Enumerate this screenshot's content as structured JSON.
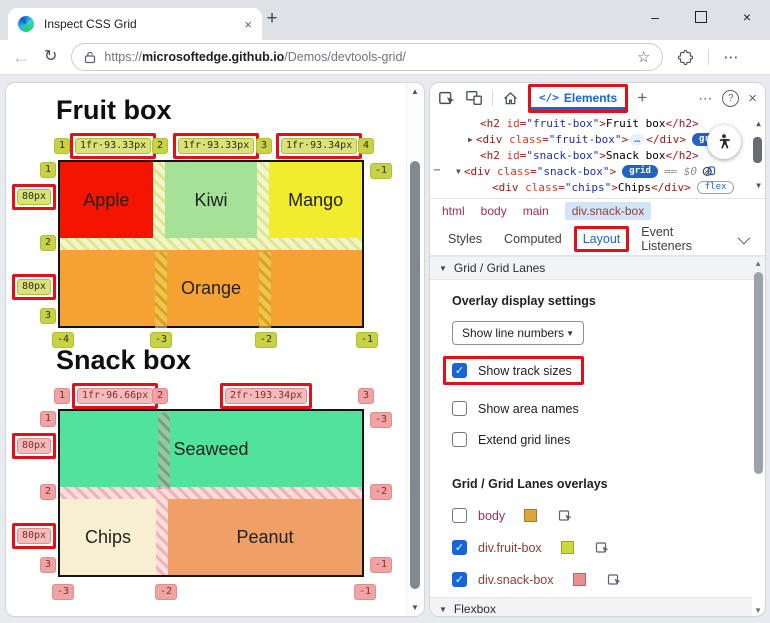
{
  "browser": {
    "tab_title": "Inspect CSS Grid",
    "url": {
      "scheme": "https://",
      "host": "microsoftedge.github.io",
      "path": "/Demos/devtools-grid/"
    },
    "icons": {
      "back": "←",
      "refresh": "↻",
      "star": "☆",
      "more": "⋯",
      "new_tab": "+",
      "tab_close": "×",
      "minimize": "–",
      "close": "×"
    }
  },
  "page": {
    "fruit": {
      "title": "Fruit box",
      "cells": [
        "Apple",
        "Kiwi",
        "Mango",
        "Orange"
      ],
      "top_lines": [
        "1",
        "2",
        "3",
        "4"
      ],
      "tracks": [
        "1fr·93.33px",
        "1fr·93.33px",
        "1fr·93.34px"
      ],
      "left_lines": [
        "1",
        "2",
        "3"
      ],
      "row_size": "80px",
      "right_line": "-1",
      "bottom_lines": [
        "-4",
        "-3",
        "-2",
        "-1"
      ]
    },
    "snack": {
      "title": "Snack box",
      "cells": [
        "Seaweed",
        "Chips",
        "Peanut"
      ],
      "top_lines": [
        "1",
        "2",
        "3"
      ],
      "tracks": [
        "1fr·96.66px",
        "2fr·193.34px"
      ],
      "left_lines": [
        "1",
        "2",
        "3"
      ],
      "row_size": "80px",
      "right_lines": [
        "-3",
        "-2",
        "-1"
      ],
      "bottom_lines": [
        "-3",
        "-2",
        "-1"
      ]
    }
  },
  "devtools": {
    "toolbar": {
      "elements_glyph": "</>",
      "elements_label": "Elements",
      "new_tab": "+",
      "more": "⋯",
      "help": "?",
      "close": "×"
    },
    "tree": {
      "l1": [
        "<h2",
        " id",
        "=",
        "\"fruit-box\"",
        ">",
        "Fruit box",
        "</h2>"
      ],
      "l2": [
        "<div",
        " class",
        "=",
        "\"fruit-box\"",
        ">",
        "…",
        "</div>"
      ],
      "l3": [
        "<h2",
        " id",
        "=",
        "\"snack-box\"",
        ">",
        "Snack box",
        "</h2>"
      ],
      "l4": [
        "<div",
        " class",
        "=",
        "\"snack-box\"",
        ">"
      ],
      "l5": [
        "<div",
        " class",
        "=",
        "\"chips\"",
        ">",
        "Chips",
        "</div>"
      ],
      "grid_badge": "grid",
      "flex_badge": "flex",
      "selected_hint": "== $0",
      "gutter_dots": "⋯"
    },
    "breadcrumbs": [
      "html",
      "body",
      "main",
      "div.snack-box"
    ],
    "tabs": [
      "Styles",
      "Computed",
      "Layout",
      "Event Listeners"
    ],
    "layout": {
      "grid_section": "Grid / Grid Lanes",
      "overlay_settings": "Overlay display settings",
      "line_numbers_dropdown": "Show line numbers",
      "check_glyph": "✓",
      "checkboxes": [
        {
          "label": "Show track sizes",
          "checked": true
        },
        {
          "label": "Show area names",
          "checked": false
        },
        {
          "label": "Extend grid lines",
          "checked": false
        }
      ],
      "overlays_title": "Grid / Grid Lanes overlays",
      "overlays": [
        {
          "label": "body",
          "checked": false,
          "swatch": "#e0a43d"
        },
        {
          "label": "div.fruit-box",
          "checked": true,
          "swatch": "#cdd93a"
        },
        {
          "label": "div.snack-box",
          "checked": true,
          "swatch": "#ec8e8e"
        }
      ],
      "flex_section": "Flexbox"
    }
  },
  "colors": {
    "annotation_red": "#e3101c",
    "accent_blue": "#1766d9",
    "apple": "#f41400",
    "kiwi": "#a5e196",
    "mango": "#f1ec2e",
    "orange": "#f5a233",
    "seaweed": "#50e39b",
    "chips": "#f8efd2",
    "peanut": "#f09f66",
    "fruit_overlay_badge": "#c8d245",
    "snack_overlay_badge": "#efa3a3"
  },
  "glyphs": {
    "down_tri": "▼",
    "right_tri": "▶",
    "up_tri": "▲"
  }
}
